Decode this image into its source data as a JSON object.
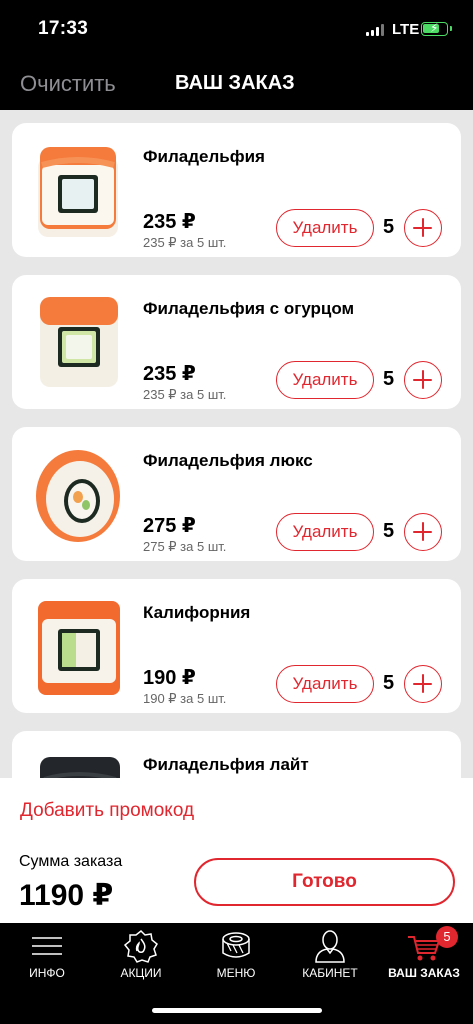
{
  "status_bar": {
    "time": "17:33",
    "network": "LTE"
  },
  "header": {
    "clear_label": "Очистить",
    "title": "ВАШ ЗАКАЗ"
  },
  "items": [
    {
      "name": "Филадельфия",
      "price": "235 ₽",
      "subtotal": "235 ₽ за 5 шт.",
      "delete_label": "Удалить",
      "quantity": "5"
    },
    {
      "name": "Филадельфия с огурцом",
      "price": "235 ₽",
      "subtotal": "235 ₽ за 5 шт.",
      "delete_label": "Удалить",
      "quantity": "5"
    },
    {
      "name": "Филадельфия люкс",
      "price": "275 ₽",
      "subtotal": "275 ₽ за 5 шт.",
      "delete_label": "Удалить",
      "quantity": "5"
    },
    {
      "name": "Калифорния",
      "price": "190 ₽",
      "subtotal": "190 ₽ за 5 шт.",
      "delete_label": "Удалить",
      "quantity": "5"
    },
    {
      "name": "Филадельфия лайт"
    }
  ],
  "summary": {
    "promo_link": "Добавить промокод",
    "sum_label": "Сумма заказа",
    "sum_value": "1190 ₽",
    "done_label": "Готово"
  },
  "tabbar": {
    "tabs": [
      {
        "label": "ИНФО",
        "icon": "menu-lines-icon"
      },
      {
        "label": "АКЦИИ",
        "icon": "flame-badge-icon"
      },
      {
        "label": "МЕНЮ",
        "icon": "sushi-roll-icon"
      },
      {
        "label": "КАБИНЕТ",
        "icon": "user-icon"
      },
      {
        "label": "ВАШ ЗАКАЗ",
        "icon": "cart-icon",
        "badge": "5",
        "active": true
      }
    ]
  },
  "colors": {
    "accent": "#e0262e",
    "background": "#e7e7e7",
    "bar": "#000000"
  }
}
